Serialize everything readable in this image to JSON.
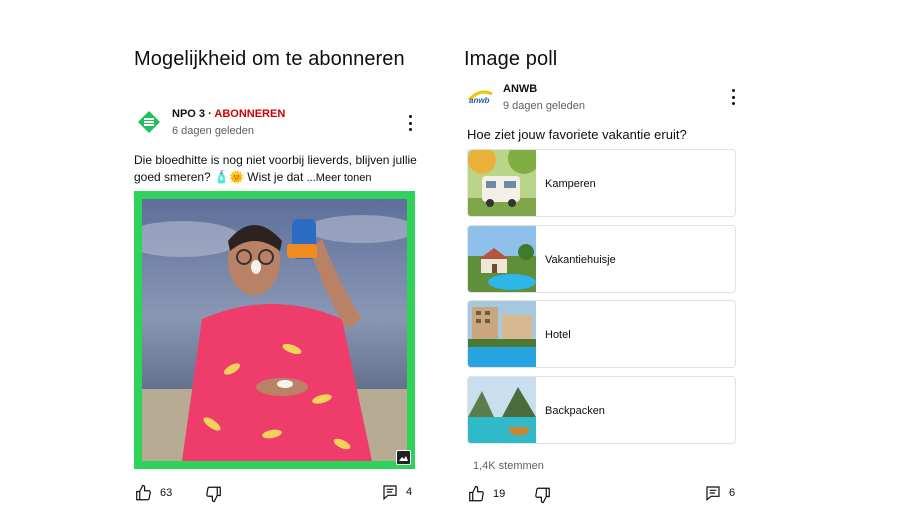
{
  "left_column": {
    "title": "Mogelijkheid om te abonneren",
    "post": {
      "channel_name": "NPO 3",
      "separator": " · ",
      "subscribe_label": "ABONNEREN",
      "time_ago": "6 dagen geleden",
      "text": "Die bloedhitte is nog niet voorbij lieverds, blijven jullie goed smeren? 🧴🌞 Wist je dat ",
      "more_label": "...Meer tonen",
      "likes": "63",
      "comments": "4"
    }
  },
  "right_column": {
    "title": "Image poll",
    "post": {
      "channel_name": "ANWB",
      "logo_text": "anwb",
      "time_ago": "9 dagen geleden",
      "question": "Hoe ziet jouw favoriete vakantie eruit?",
      "options": [
        {
          "label": "Kamperen"
        },
        {
          "label": "Vakantiehuisje"
        },
        {
          "label": "Hotel"
        },
        {
          "label": "Backpacken"
        }
      ],
      "votes": "1,4K stemmen",
      "likes": "19",
      "comments": "6"
    }
  },
  "colors": {
    "accent_subscribe": "#cc0000",
    "media_border": "#2fd35a",
    "npo_green": "#1fc25a",
    "anwb_blue": "#1f5fb8"
  }
}
